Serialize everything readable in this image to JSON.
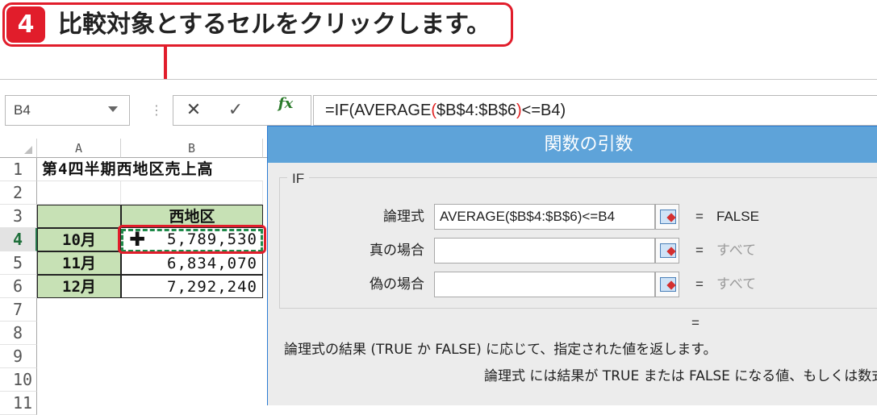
{
  "instruction": {
    "step_number": "4",
    "text": "比較対象とするセルをクリックします。"
  },
  "formula_bar": {
    "name_box": "B4",
    "formula_prefix": "=IF(AVERAGE",
    "paren_open": "(",
    "formula_range": "$B$4:$B$6",
    "paren_close": ")",
    "formula_suffix": "<=B4)",
    "cancel_symbol": "✕",
    "enter_symbol": "✓",
    "fx_label": "fx"
  },
  "sheet": {
    "columns": [
      "A",
      "B"
    ],
    "row_numbers": [
      "1",
      "2",
      "3",
      "4",
      "5",
      "6",
      "7",
      "8",
      "9",
      "10",
      "11"
    ],
    "title": "第4四半期西地区売上高",
    "header_b": "西地区",
    "rows": [
      {
        "label": "10月",
        "value": "5,789,530"
      },
      {
        "label": "11月",
        "value": "6,834,070"
      },
      {
        "label": "12月",
        "value": "7,292,240"
      }
    ]
  },
  "dialog": {
    "title": "関数の引数",
    "function_name": "IF",
    "args": [
      {
        "label": "論理式",
        "value": "AVERAGE($B$4:$B$6)<=B4",
        "eq": "=",
        "result": "FALSE"
      },
      {
        "label": "真の場合",
        "value": "",
        "eq": "=",
        "result": "すべて"
      },
      {
        "label": "偽の場合",
        "value": "",
        "eq": "=",
        "result": "すべて"
      }
    ],
    "formula_result_eq": "=",
    "description": "論理式の結果 (TRUE か FALSE) に応じて、指定された値を返します。",
    "arg_description": "論理式  には結果が TRUE または FALSE になる値、もしくは数式を指定"
  },
  "colors": {
    "callout_red": "#e11d2b",
    "excel_green": "#217346",
    "header_fill": "#c7e1b5",
    "dialog_title_blue": "#5ea3d9"
  }
}
